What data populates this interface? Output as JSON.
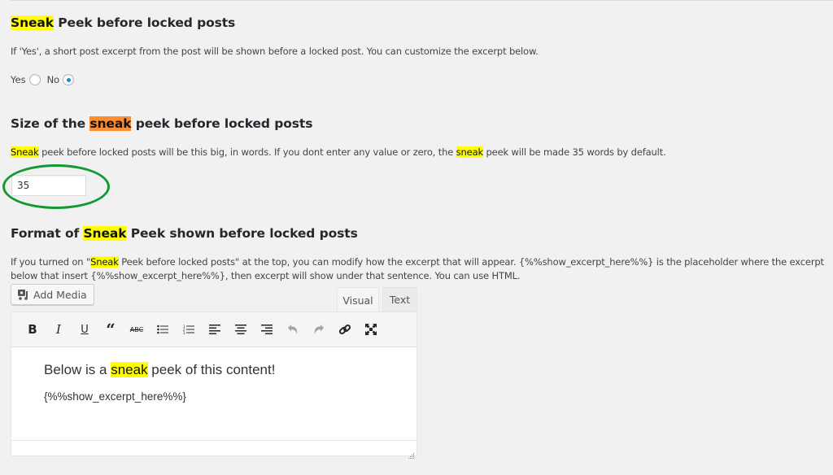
{
  "section1": {
    "title_highlight": "Sneak",
    "title_rest": " Peek before locked posts",
    "description": "If 'Yes', a short post excerpt from the post will be shown before a locked post. You can customize the excerpt below.",
    "options": [
      {
        "label": "Yes",
        "checked": false
      },
      {
        "label": "No",
        "checked": true
      }
    ]
  },
  "section2": {
    "title_pre": "Size of the ",
    "title_highlight": "sneak",
    "title_post": " peek before locked posts",
    "desc_highlight1": "Sneak",
    "desc_mid": " peek before locked posts will be this big, in words. If you dont enter any value or zero, the ",
    "desc_highlight2": "sneak",
    "desc_post": " peek will be made 35 words by default.",
    "input_value": "35",
    "annotation_color": "#129a32"
  },
  "section3": {
    "title_pre": "Format of ",
    "title_highlight": "Sneak",
    "title_post": " Peek shown before locked posts",
    "desc_line1_pre": "If you turned on \"",
    "desc_line1_highlight": "Sneak",
    "desc_line1_post": " Peek before locked posts\" at the top, you can modify how the excerpt that will appear. {%%show_excerpt_here%%} is the placeholder where the excerpt",
    "desc_line2": "below that insert {%%show_excerpt_here%%}, then excerpt will show under that sentence. You can use HTML."
  },
  "editor": {
    "add_media_label": "Add Media",
    "tabs": [
      {
        "label": "Visual",
        "active": true
      },
      {
        "label": "Text",
        "active": false
      }
    ],
    "toolbar": [
      {
        "name": "bold",
        "glyph": "B"
      },
      {
        "name": "italic",
        "glyph": "I"
      },
      {
        "name": "underline",
        "glyph": "U"
      },
      {
        "name": "blockquote",
        "glyph": "❝"
      },
      {
        "name": "strikethrough",
        "glyph": "ABC"
      },
      {
        "name": "bullet-list",
        "glyph": "☰"
      },
      {
        "name": "numbered-list",
        "glyph": "☰"
      },
      {
        "name": "align-left",
        "glyph": "≡"
      },
      {
        "name": "align-center",
        "glyph": "≡"
      },
      {
        "name": "align-right",
        "glyph": "≡"
      },
      {
        "name": "undo",
        "glyph": "↶"
      },
      {
        "name": "redo",
        "glyph": "↷"
      },
      {
        "name": "link",
        "glyph": "🔗"
      },
      {
        "name": "fullscreen",
        "glyph": "⤢"
      }
    ],
    "content_line1_pre": "Below is a ",
    "content_line1_highlight": "sneak",
    "content_line1_post": " peek of this content!",
    "content_line2": "{%%show_excerpt_here%%}"
  }
}
